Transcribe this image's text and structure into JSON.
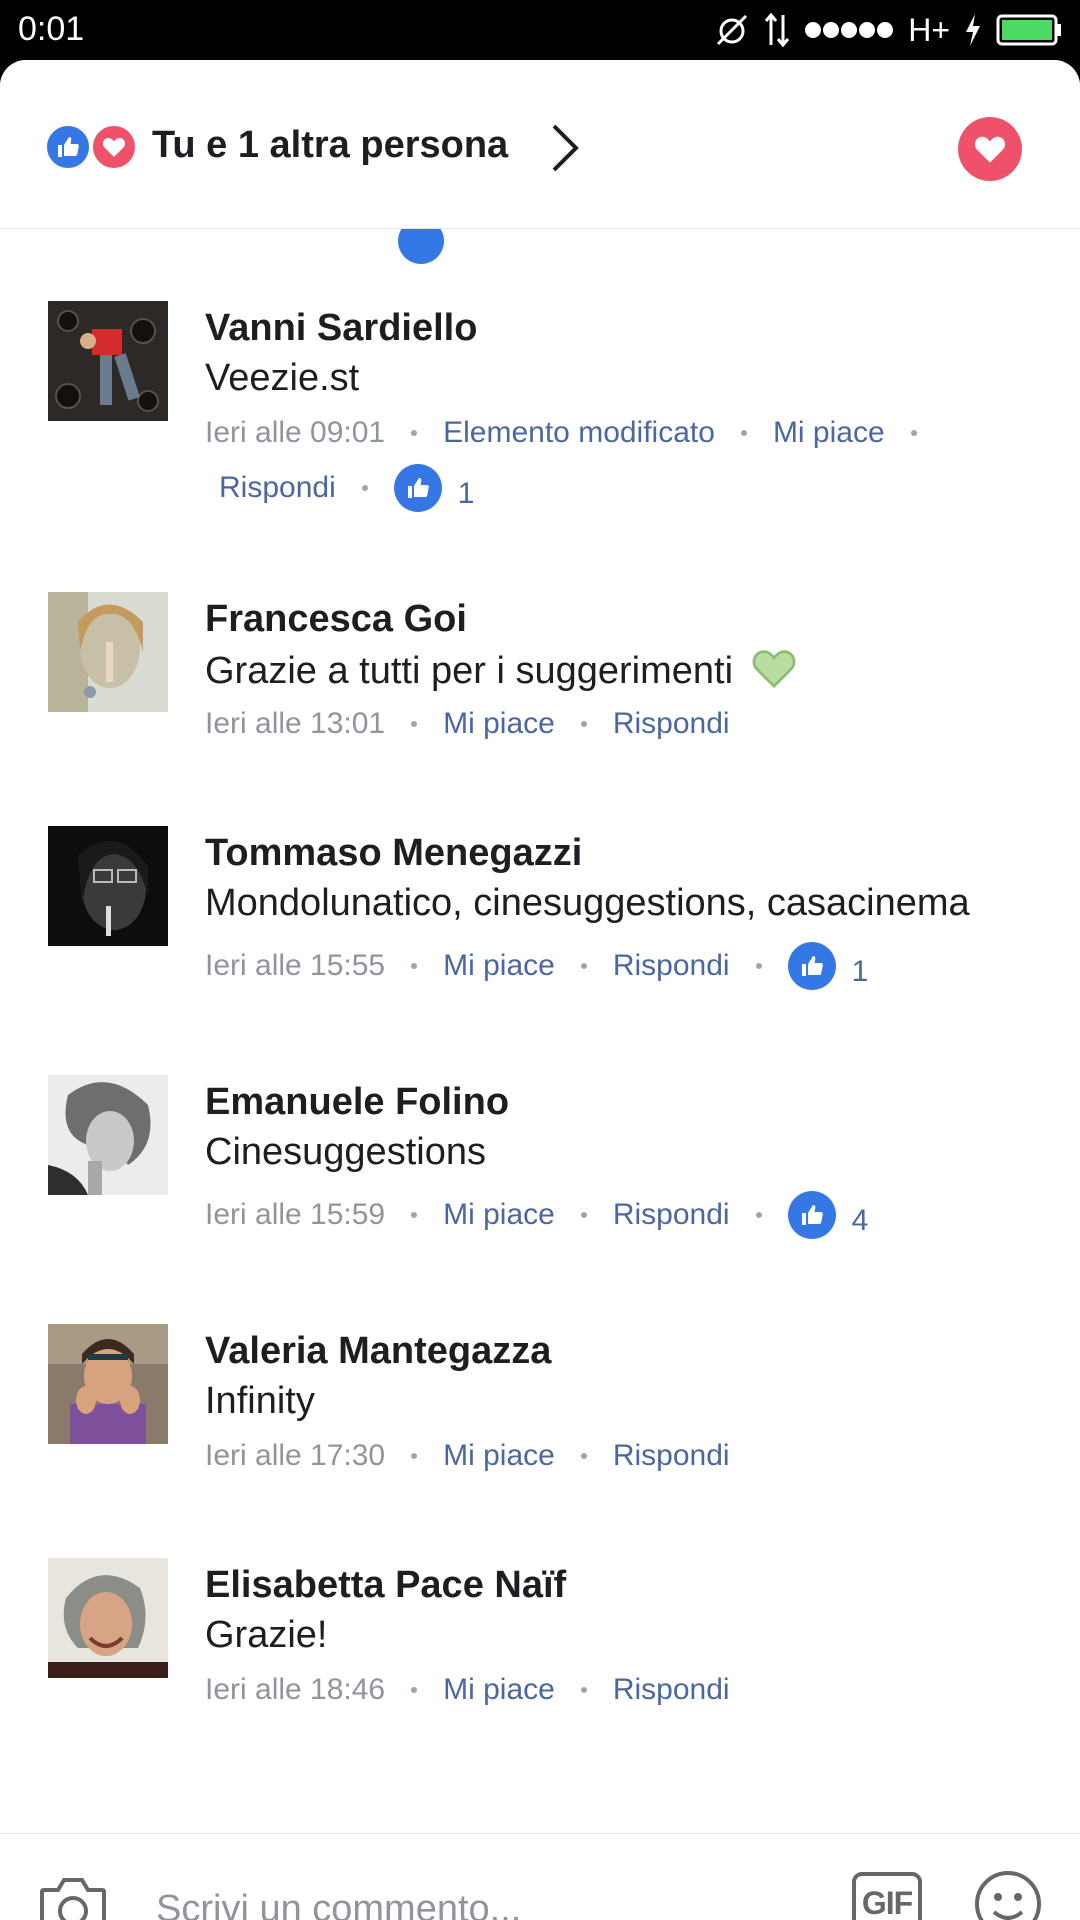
{
  "status_bar": {
    "time": "0:01",
    "network": "H+"
  },
  "header": {
    "summary": "Tu e 1 altra persona"
  },
  "comments": [
    {
      "name": "Vanni Sardiello",
      "text": "Veezie.st",
      "time": "Ieri alle 09:01",
      "edited": "Elemento modificato",
      "like": "Mi piace",
      "reply": "Rispondi",
      "likes": "1"
    },
    {
      "name": "Francesca Goi",
      "text": "Grazie a tutti per i suggerimenti",
      "time": "Ieri alle 13:01",
      "like": "Mi piace",
      "reply": "Rispondi"
    },
    {
      "name": "Tommaso Menegazzi",
      "text": "Mondolunatico, cinesuggestions, casacinema",
      "time": "Ieri alle 15:55",
      "like": "Mi piace",
      "reply": "Rispondi",
      "likes": "1"
    },
    {
      "name": "Emanuele Folino",
      "text": "Cinesuggestions",
      "time": "Ieri alle 15:59",
      "like": "Mi piace",
      "reply": "Rispondi",
      "likes": "4"
    },
    {
      "name": "Valeria Mantegazza",
      "text": "Infinity",
      "time": "Ieri alle 17:30",
      "like": "Mi piace",
      "reply": "Rispondi"
    },
    {
      "name": "Elisabetta Pace Naïf",
      "text": "Grazie!",
      "time": "Ieri alle 18:46",
      "like": "Mi piace",
      "reply": "Rispondi"
    }
  ],
  "composer": {
    "placeholder": "Scrivi un commento...",
    "gif_label": "GIF"
  },
  "colors": {
    "like_blue": "#3578e5",
    "love_red": "#f0516a",
    "link": "#4b67a1",
    "meta_gray": "#90949c"
  }
}
